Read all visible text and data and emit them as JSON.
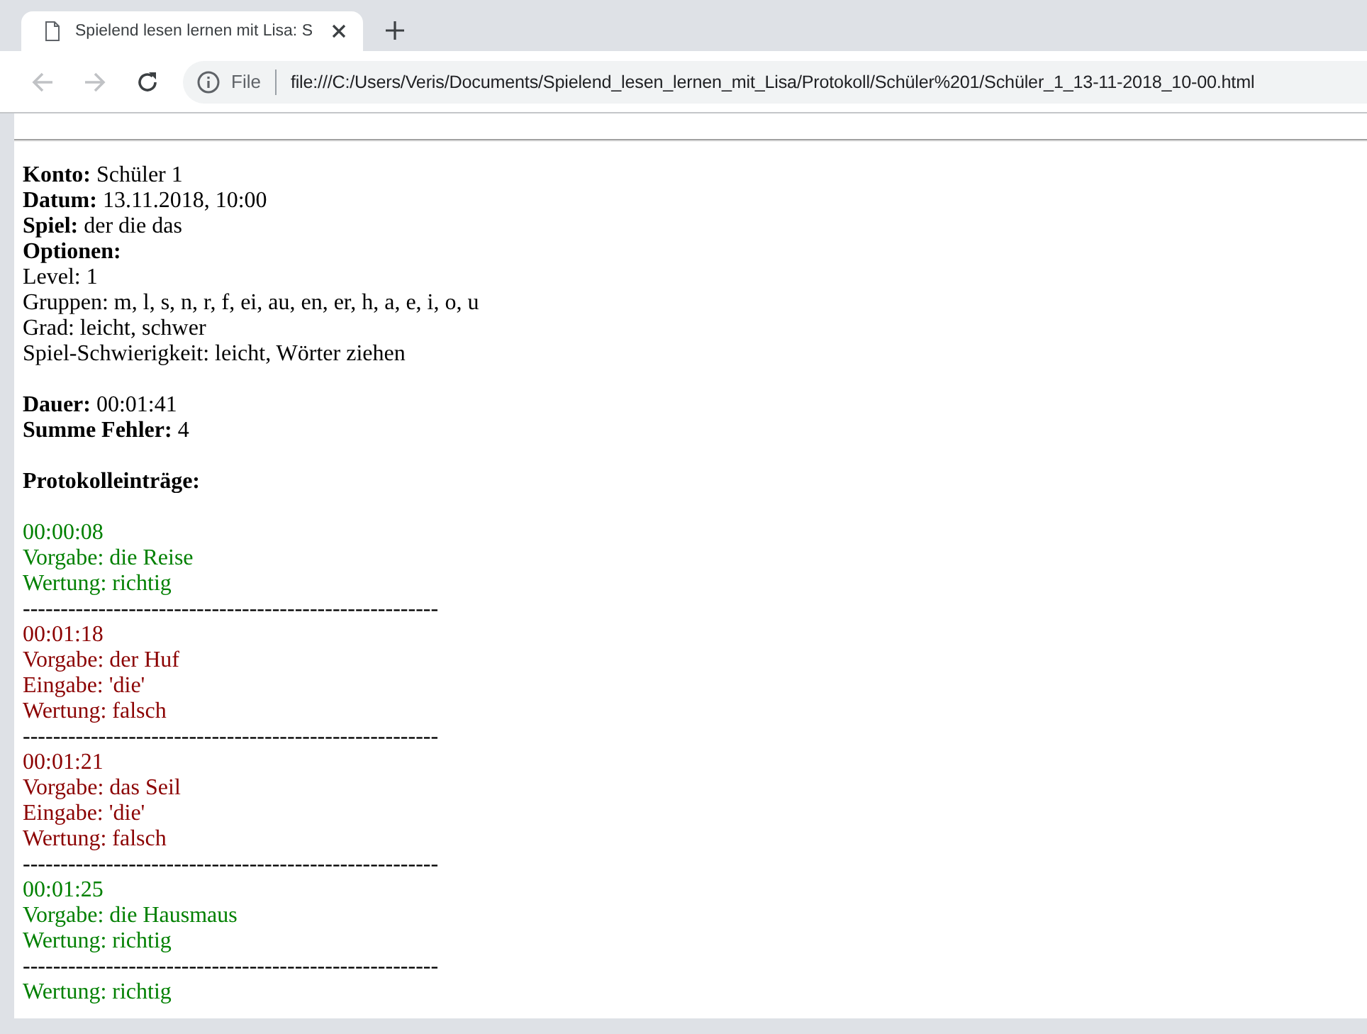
{
  "browser": {
    "tab": {
      "title": "Spielend lesen lernen mit Lisa: S"
    },
    "nav": {
      "back_disabled": true,
      "forward_disabled": true
    },
    "address_bar": {
      "scheme": "File",
      "url": "file:///C:/Users/Veris/Documents/Spielend_lesen_lernen_mit_Lisa/Protokoll/Schüler%201/Schüler_1_13-11-2018_10-00.html"
    }
  },
  "page": {
    "header": [
      {
        "label": "Konto:",
        "value": "Schüler 1"
      },
      {
        "label": "Datum:",
        "value": "13.11.2018, 10:00"
      },
      {
        "label": "Spiel:",
        "value": "der die das"
      },
      {
        "label": "Optionen:"
      }
    ],
    "options": [
      "Level: 1",
      "Gruppen: m, l, s, n, r, f, ei, au, en, er, h, a, e, i, o, u",
      "Grad: leicht, schwer",
      "Spiel-Schwierigkeit: leicht, Wörter ziehen"
    ],
    "summary": [
      {
        "label": "Dauer:",
        "value": "00:01:41"
      },
      {
        "label": "Summe Fehler:",
        "value": "4"
      }
    ],
    "log_title": "Protokolleinträge:",
    "log": [
      {
        "kind": "entry",
        "correct": true,
        "lines": [
          "00:00:08",
          "Vorgabe: die Reise",
          "Wertung: richtig"
        ]
      },
      {
        "kind": "separator",
        "text": "-------------------------------------------------------"
      },
      {
        "kind": "entry",
        "correct": false,
        "lines": [
          "00:01:18",
          "Vorgabe: der Huf",
          "Eingabe: 'die'",
          "Wertung: falsch"
        ]
      },
      {
        "kind": "separator",
        "text": "-------------------------------------------------------"
      },
      {
        "kind": "entry",
        "correct": false,
        "lines": [
          "00:01:21",
          "Vorgabe: das Seil",
          "Eingabe: 'die'",
          "Wertung: falsch"
        ]
      },
      {
        "kind": "separator",
        "text": "-------------------------------------------------------"
      },
      {
        "kind": "entry",
        "correct": true,
        "lines": [
          "00:01:25",
          "Vorgabe: die Hausmaus",
          "Wertung: richtig"
        ]
      },
      {
        "kind": "separator",
        "text": "-------------------------------------------------------"
      },
      {
        "kind": "entry",
        "correct": true,
        "lines": [
          "Wertung: richtig"
        ]
      }
    ]
  }
}
